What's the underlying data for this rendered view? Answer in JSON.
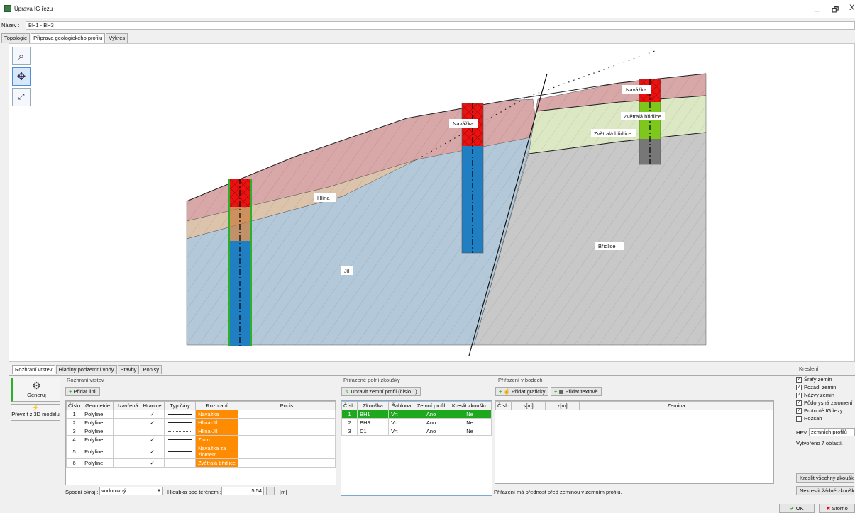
{
  "window": {
    "title": "Úprava IG řezu",
    "minimize": "_",
    "restore": "🗗",
    "close": "X"
  },
  "name_field": {
    "label": "Název :",
    "value": "BH1 - BH3"
  },
  "top_tabs": [
    "Topologie",
    "Příprava geologického profilu",
    "Výkres"
  ],
  "toolbox": {
    "zoom": "zoom-icon",
    "move": "move-icon",
    "fit": "fit-icon"
  },
  "drawing": {
    "soil_labels": [
      "Navážka",
      "Navážka",
      "Zvětralá břidlice",
      "Zvětralá břidlice",
      "Hlína",
      "Jíl",
      "Břidlice"
    ],
    "colors": {
      "navazka": "#d8a7a7",
      "hlina": "#dcc4ac",
      "jil": "#b3c8d8",
      "zvetrala": "#dce8c4",
      "bridlice": "#c8c8c8"
    }
  },
  "bottom_tabs": [
    "Rozhraní vrstev",
    "Hladiny podzemní vody",
    "Stavby",
    "Popisy"
  ],
  "left_buttons": {
    "generate": "Generuj",
    "import3d": "Převzít z 3D modelu"
  },
  "interfaces": {
    "group_title": "Rozhraní vrstev",
    "add_button": "Přidat linii",
    "headers": [
      "Číslo",
      "Geometrie",
      "Uzavřená",
      "Hranice",
      "Typ čáry",
      "Rozhraní",
      "Popis"
    ],
    "rows": [
      {
        "n": "1",
        "geom": "Polyline",
        "closed": "",
        "border": "✓",
        "line": "solid",
        "iface": "Navážka",
        "desc": ""
      },
      {
        "n": "2",
        "geom": "Polyline",
        "closed": "",
        "border": "✓",
        "line": "solid",
        "iface": "Hlína-Jíl",
        "desc": ""
      },
      {
        "n": "3",
        "geom": "Polyline",
        "closed": "",
        "border": "",
        "line": "dotted",
        "iface": "Hlína-Jíl",
        "desc": ""
      },
      {
        "n": "4",
        "geom": "Polyline",
        "closed": "",
        "border": "✓",
        "line": "solid",
        "iface": "Zlom",
        "desc": ""
      },
      {
        "n": "5",
        "geom": "Polyline",
        "closed": "",
        "border": "✓",
        "line": "solid",
        "iface": "Navážka za zlomem",
        "desc": ""
      },
      {
        "n": "6",
        "geom": "Polyline",
        "closed": "",
        "border": "✓",
        "line": "solid",
        "iface": "Zvětralá břidlice",
        "desc": ""
      }
    ],
    "bottom_label": "Spodní okraj :",
    "bottom_value": "vodorovný",
    "depth_label": "Hloubka pod terénem :",
    "depth_value": "5,54",
    "depth_unit": "[m]",
    "dots_button": "..."
  },
  "field_tests": {
    "group_title": "Přiřazené polní zkoušky",
    "edit_button": "Upravit zemní profil (číslo 1)",
    "headers": [
      "Číslo",
      "Zkouška",
      "Šablona",
      "Zemní profil",
      "Kreslit zkoušku"
    ],
    "rows": [
      {
        "n": "1",
        "test": "BH1",
        "tpl": "Vrt",
        "profile": "Ano",
        "draw": "Ne"
      },
      {
        "n": "2",
        "test": "BH3",
        "tpl": "Vrt",
        "profile": "Ano",
        "draw": "Ne"
      },
      {
        "n": "3",
        "test": "C1",
        "tpl": "Vrt",
        "profile": "Ano",
        "draw": "Ne"
      }
    ]
  },
  "points": {
    "group_title": "Přiřazení v bodech",
    "add_graphic": "Přidat graficky",
    "add_text": "Přidat textově",
    "headers": [
      "Číslo",
      "s[m]",
      "z[m]",
      "Zemina"
    ],
    "note": "Přiřazení má přednost před zeminou v zemním profilu."
  },
  "draw_options": {
    "group_title": "Kreslení",
    "items": [
      {
        "label": "Šrafy zemin",
        "checked": true
      },
      {
        "label": "Pozadí zemin",
        "checked": true
      },
      {
        "label": "Názvy zemin",
        "checked": true
      },
      {
        "label": "Půdorysná zalomení",
        "checked": true
      },
      {
        "label": "Protnuté IG řezy",
        "checked": true
      },
      {
        "label": "Rozsah",
        "checked": false
      }
    ],
    "hpv_label": "HPV :",
    "hpv_value": "zemních profilů",
    "areas_text": "Vytvořeno 7 oblastí.",
    "draw_all": "Kreslit všechny zkoušky",
    "draw_none": "Nekreslit žádné zkoušky"
  },
  "footer": {
    "ok": "OK",
    "cancel": "Storno"
  }
}
